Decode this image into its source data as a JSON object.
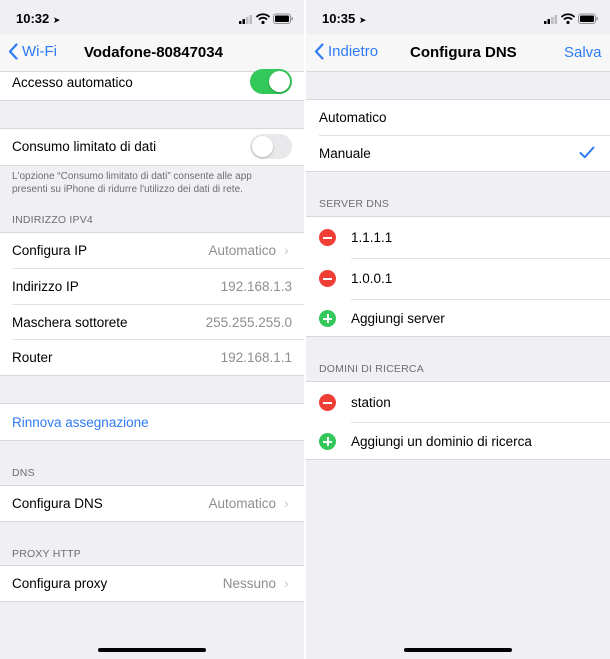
{
  "left": {
    "status": {
      "time": "10:32"
    },
    "nav": {
      "back_label": "Wi-Fi",
      "title": "Vodafone-80847034"
    },
    "auto_join": {
      "label": "Accesso automatico",
      "on": true
    },
    "low_data": {
      "label": "Consumo limitato di dati",
      "on": false,
      "footer_line1": "L'opzione “Consumo limitato di dati” consente alle app",
      "footer_line2": "presenti su iPhone di ridurre l'utilizzo dei dati di rete."
    },
    "ipv4": {
      "header": "INDIRIZZO IPV4",
      "rows": [
        {
          "label": "Configura IP",
          "value": "Automatico"
        },
        {
          "label": "Indirizzo IP",
          "value": "192.168.1.3"
        },
        {
          "label": "Maschera sottorete",
          "value": "255.255.255.0"
        },
        {
          "label": "Router",
          "value": "192.168.1.1"
        }
      ]
    },
    "renew": {
      "label": "Rinnova assegnazione"
    },
    "dns": {
      "header": "DNS",
      "label": "Configura DNS",
      "value": "Automatico"
    },
    "proxy": {
      "header": "PROXY HTTP",
      "label": "Configura proxy",
      "value": "Nessuno"
    }
  },
  "right": {
    "status": {
      "time": "10:35"
    },
    "nav": {
      "back_label": "Indietro",
      "title": "Configura DNS",
      "action_label": "Salva"
    },
    "mode": {
      "options": [
        "Automatico",
        "Manuale"
      ],
      "selected": "Manuale"
    },
    "servers": {
      "header": "SERVER DNS",
      "items": [
        "1.1.1.1",
        "1.0.0.1"
      ],
      "add_label": "Aggiungi server"
    },
    "domains": {
      "header": "DOMINI DI RICERCA",
      "items": [
        "station"
      ],
      "add_label": "Aggiungi un dominio di ricerca"
    }
  },
  "colors": {
    "accent": "#2f7bf5",
    "toggle_on": "#34c759",
    "remove": "#ef3e36",
    "add": "#34c759"
  },
  "icons": [
    "location-arrow-icon",
    "signal-icon",
    "wifi-icon",
    "battery-icon",
    "back-chevron-icon",
    "chevron-right-icon",
    "checkmark-icon",
    "remove-circle-icon",
    "add-circle-icon"
  ]
}
